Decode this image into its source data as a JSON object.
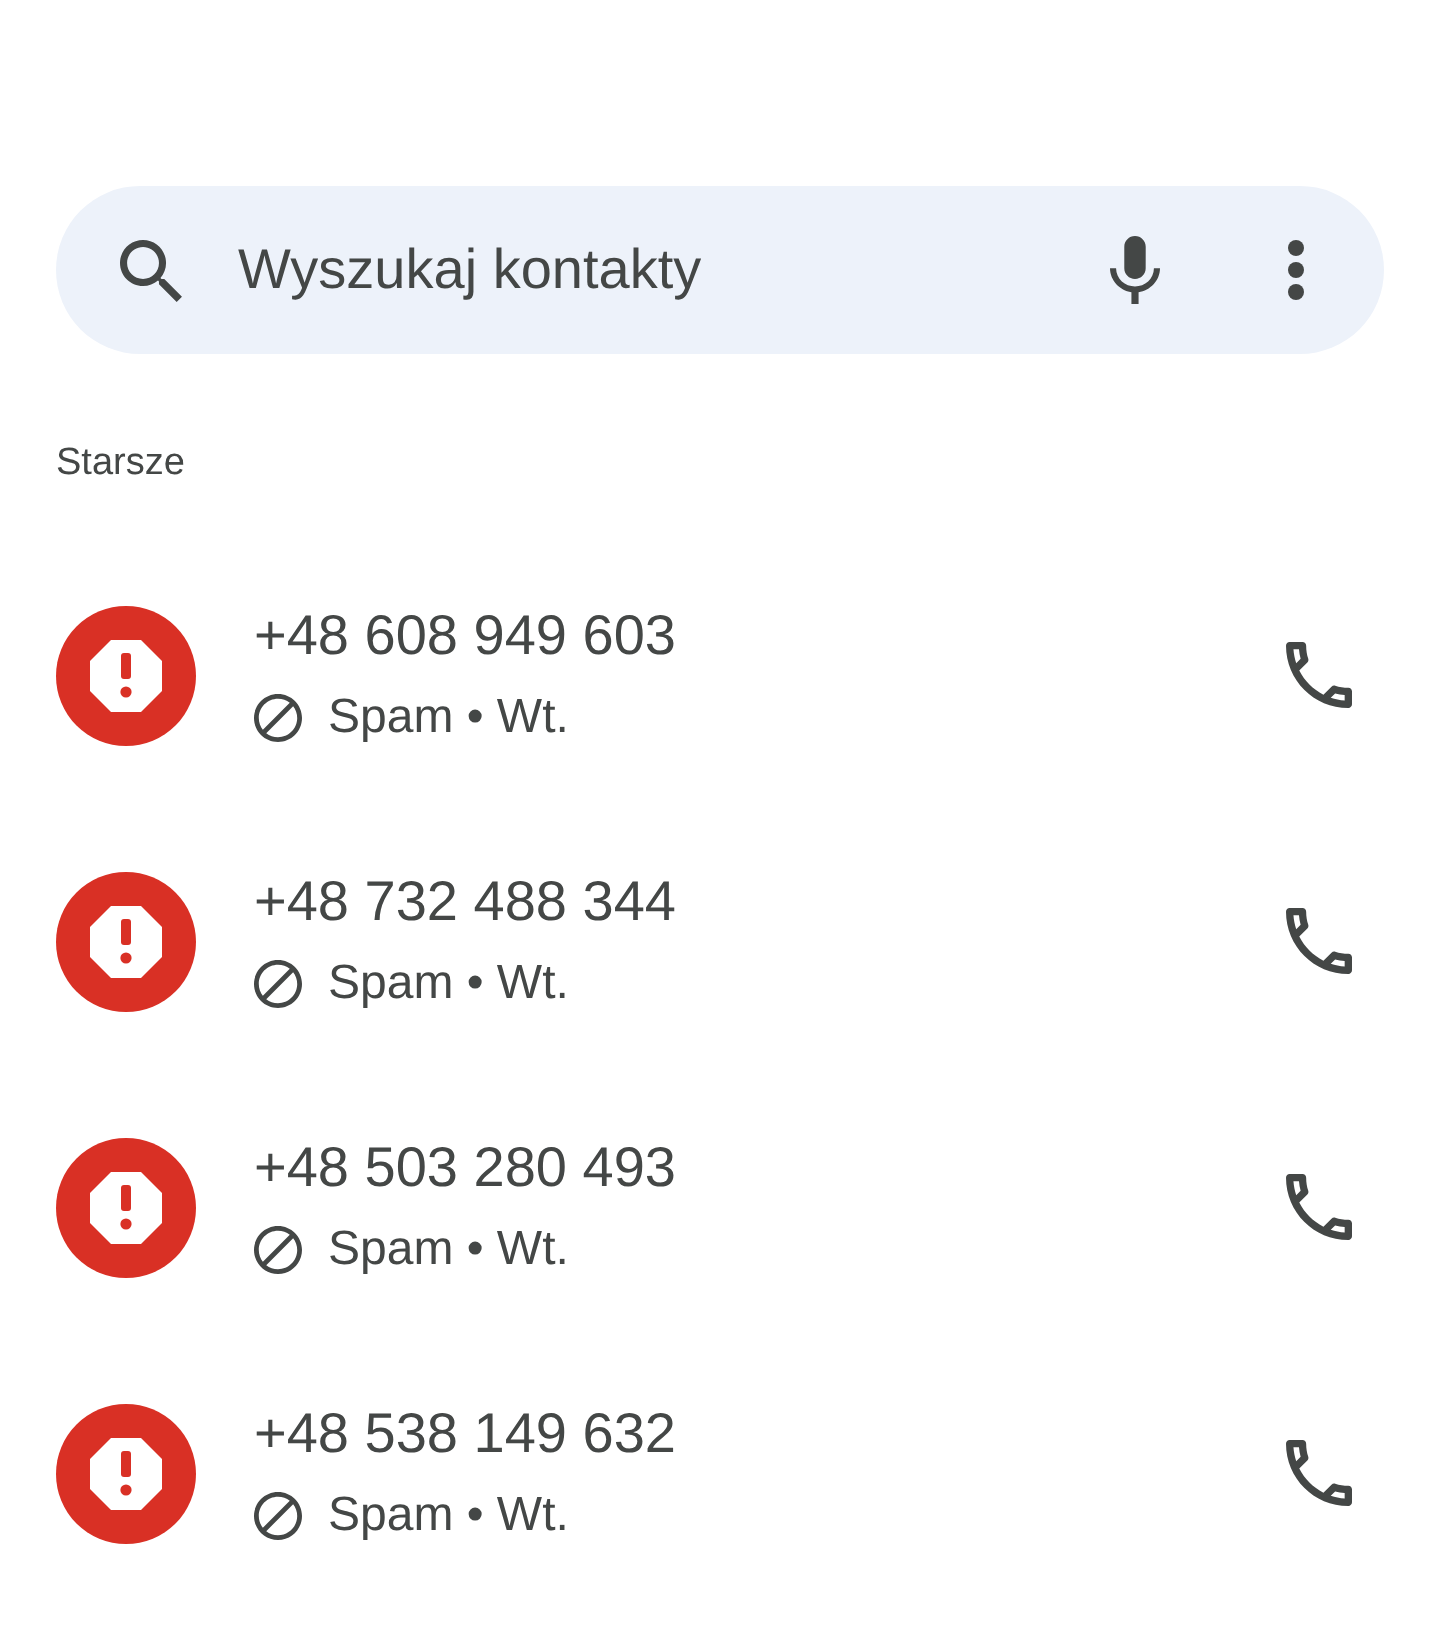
{
  "search": {
    "placeholder": "Wyszukaj kontakty"
  },
  "section": {
    "title": "Starsze"
  },
  "calls": [
    {
      "number": "+48 608 949 603",
      "status": "Spam • Wt."
    },
    {
      "number": "+48 732 488 344",
      "status": "Spam • Wt."
    },
    {
      "number": "+48 503 280 493",
      "status": "Spam • Wt."
    },
    {
      "number": "+48 538 149 632",
      "status": "Spam • Wt."
    }
  ]
}
